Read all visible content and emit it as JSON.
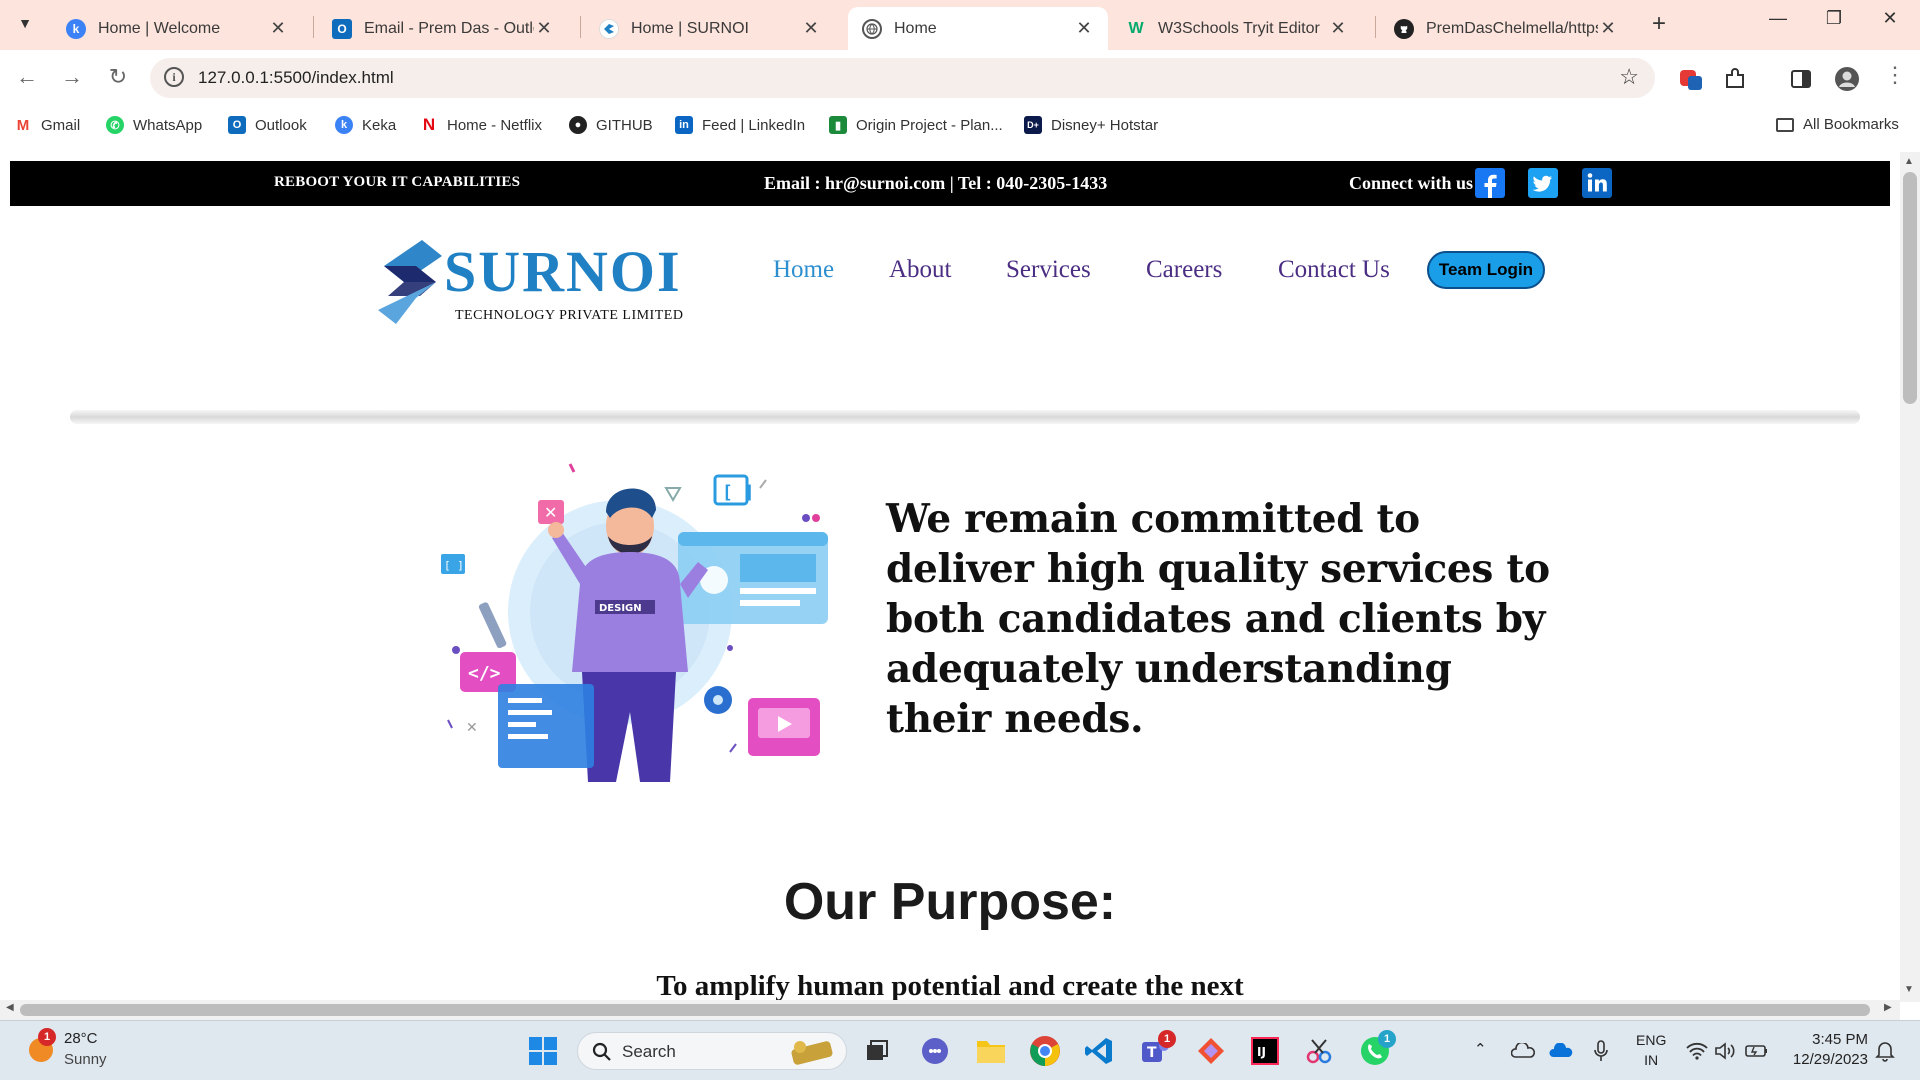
{
  "browser": {
    "tabs": [
      {
        "title": "Home | Welcome",
        "active": false
      },
      {
        "title": "Email - Prem Das - Outlook",
        "active": false
      },
      {
        "title": "Home | SURNOI",
        "active": false
      },
      {
        "title": "Home",
        "active": true
      },
      {
        "title": "W3Schools Tryit Editor",
        "active": false
      },
      {
        "title": "PremDasChelmella/https-",
        "active": false
      }
    ],
    "url": "127.0.0.1:5500/index.html",
    "bookmarks": [
      {
        "label": "Gmail"
      },
      {
        "label": "WhatsApp"
      },
      {
        "label": "Outlook"
      },
      {
        "label": "Keka"
      },
      {
        "label": "Home - Netflix"
      },
      {
        "label": "GITHUB"
      },
      {
        "label": "Feed | LinkedIn"
      },
      {
        "label": "Origin Project - Plan..."
      },
      {
        "label": "Disney+ Hotstar"
      }
    ],
    "all_bookmarks": "All Bookmarks"
  },
  "site": {
    "topbar": {
      "tagline": "REBOOT YOUR IT CAPABILITIES",
      "contact": "Email : hr@surnoi.com | Tel : 040-2305-1433",
      "connect": "Connect with us"
    },
    "logo": {
      "name": "SURNOI",
      "subtitle": "TECHNOLOGY PRIVATE LIMITED"
    },
    "nav": {
      "home": "Home",
      "about": "About",
      "services": "Services",
      "careers": "Careers",
      "contact": "Contact Us",
      "team_login": "Team Login"
    },
    "hero": {
      "illustration_badge": "DESIGN",
      "statement": "We remain committed to deliver high quality services to both candidates and clients by adequately understanding their needs."
    },
    "purpose": {
      "title": "Our Purpose:",
      "text": "To amplify human potential and create the next"
    }
  },
  "taskbar": {
    "weather_temp": "28°C",
    "weather_desc": "Sunny",
    "weather_badge": "1",
    "search_label": "Search",
    "teams_badge": "1",
    "whatsapp_badge": "1",
    "lang_1": "ENG",
    "lang_2": "IN",
    "time": "3:45 PM",
    "date": "12/29/2023"
  },
  "colors": {
    "brand_blue": "#1f80c4",
    "nav_purple": "#4b2e83",
    "team_login_bg": "#1a9ee8",
    "tab_strip": "#fde4dc"
  }
}
